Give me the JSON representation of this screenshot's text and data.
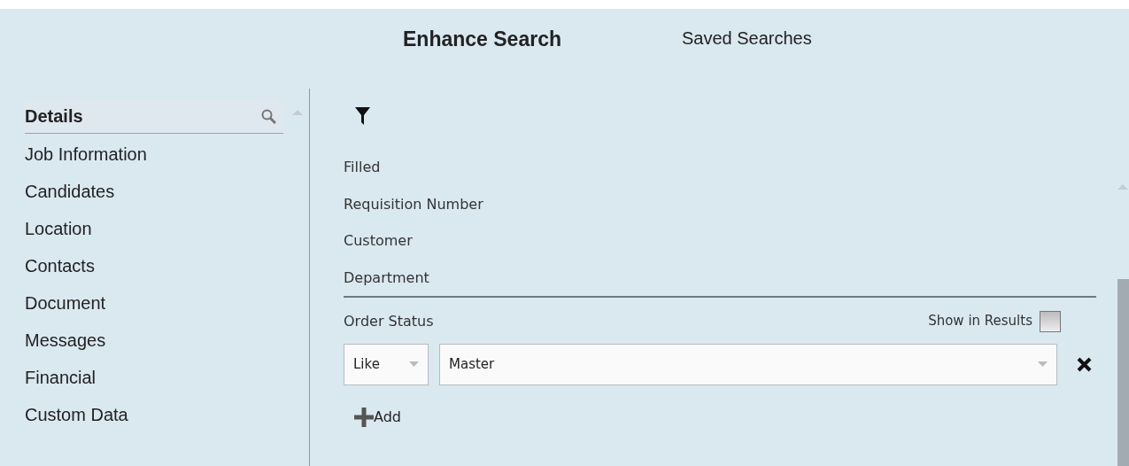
{
  "tabs": [
    {
      "label": "Enhance Search",
      "selected": true
    },
    {
      "label": "Saved Searches",
      "selected": false
    }
  ],
  "sidebar": {
    "header": "Details",
    "items": [
      {
        "label": "Job Information"
      },
      {
        "label": "Candidates"
      },
      {
        "label": "Location"
      },
      {
        "label": "Contacts"
      },
      {
        "label": "Document"
      },
      {
        "label": "Messages"
      },
      {
        "label": "Financial"
      },
      {
        "label": "Custom Data"
      }
    ]
  },
  "fields": [
    {
      "label": "Filled"
    },
    {
      "label": "Requisition Number"
    },
    {
      "label": "Customer"
    },
    {
      "label": "Department"
    }
  ],
  "criterion": {
    "label": "Order Status",
    "show_in_results": {
      "label": "Show in Results",
      "checked": false
    },
    "operator": "Like",
    "value": "Master"
  },
  "add_button": {
    "label": "Add"
  }
}
